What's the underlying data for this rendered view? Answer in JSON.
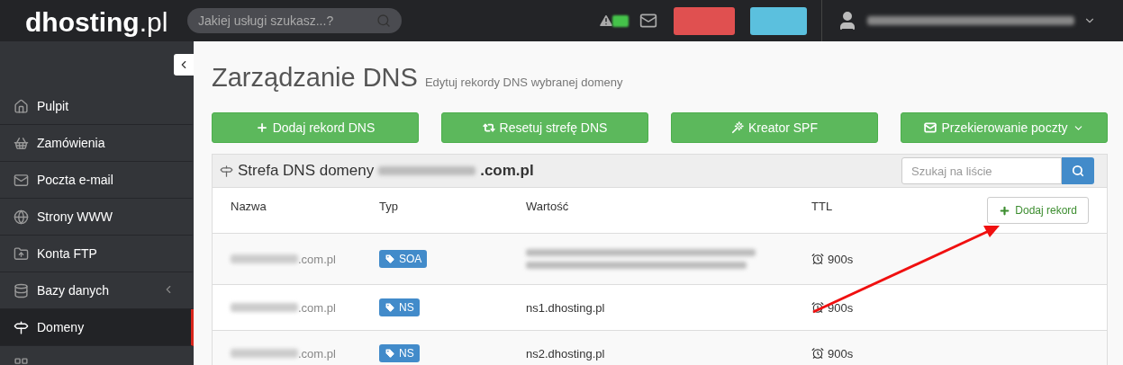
{
  "header": {
    "logo_name": "dhosting",
    "logo_suffix": ".pl",
    "search": {
      "placeholder": "Jakiej usługi szukasz...?"
    }
  },
  "sidebar": {
    "items": [
      {
        "label": "Pulpit",
        "selected": false,
        "has_submenu": false
      },
      {
        "label": "Zamówienia",
        "selected": false,
        "has_submenu": false
      },
      {
        "label": "Poczta e-mail",
        "selected": false,
        "has_submenu": false
      },
      {
        "label": "Strony WWW",
        "selected": false,
        "has_submenu": false
      },
      {
        "label": "Konta FTP",
        "selected": false,
        "has_submenu": false
      },
      {
        "label": "Bazy danych",
        "selected": false,
        "has_submenu": true
      },
      {
        "label": "Domeny",
        "selected": true,
        "has_submenu": false
      },
      {
        "selected": false
      }
    ]
  },
  "page": {
    "title": "Zarządzanie DNS",
    "subtitle": "Edytuj rekordy DNS wybranej domeny"
  },
  "actions": [
    {
      "label": "Dodaj rekord DNS",
      "dropdown": false
    },
    {
      "label": "Resetuj strefę DNS",
      "dropdown": false
    },
    {
      "label": "Kreator SPF",
      "dropdown": false
    },
    {
      "label": "Przekierowanie poczty",
      "dropdown": true
    }
  ],
  "panel": {
    "title": "Strefa DNS domeny",
    "domain_suffix": ".com.pl",
    "search": {
      "placeholder": "Szukaj na liście"
    },
    "columns": [
      "Nazwa",
      "Typ",
      "Wartość",
      "TTL"
    ],
    "add_button": "Dodaj rekord",
    "rows": [
      {
        "name_suffix": ".com.pl",
        "type": "SOA",
        "value_blurred": true,
        "ttl": "900s"
      },
      {
        "name_suffix": ".com.pl",
        "type": "NS",
        "value": "ns1.dhosting.pl",
        "value_blurred": false,
        "ttl": "900s"
      },
      {
        "name_suffix": ".com.pl",
        "type": "NS",
        "value": "ns2.dhosting.pl",
        "value_blurred": false,
        "ttl": "900s"
      }
    ]
  }
}
